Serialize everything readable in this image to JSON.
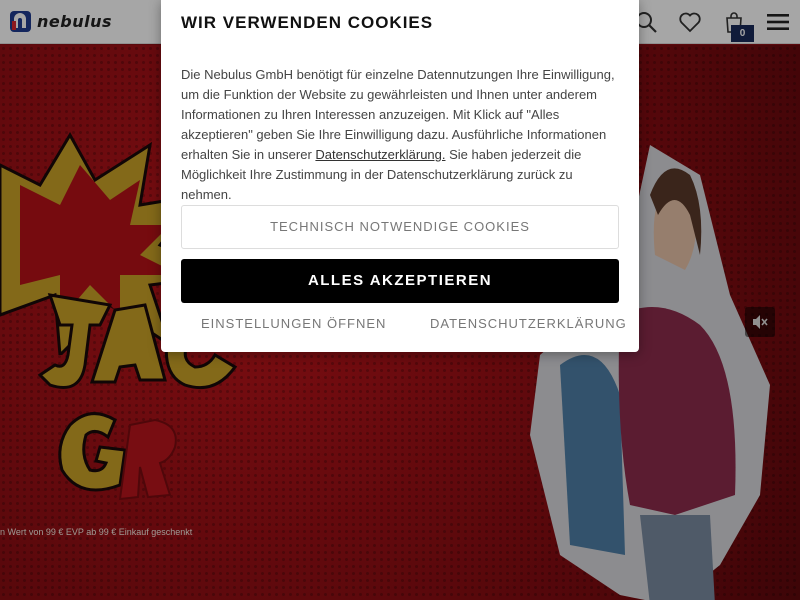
{
  "header": {
    "logo_text": "nebulus",
    "icons": [
      "search-icon",
      "heart-icon",
      "shopping-bag-icon",
      "menu-icon"
    ],
    "cart_count": "0"
  },
  "hero": {
    "caption": "n Wert von 99 € EVP ab 99 € Einkauf geschenkt",
    "mute_icon": "volume-mute-icon"
  },
  "cookie_modal": {
    "title": "WIR VERWENDEN COOKIES",
    "text_part1": "Die Nebulus GmbH benötigt für einzelne Datennutzungen Ihre Einwilligung, um die Funktion der Website zu gewährleisten und Ihnen unter anderem Informationen zu Ihren Interessen anzuzeigen. Mit Klick auf \"Alles akzeptieren\" geben Sie Ihre Einwilligung dazu. Ausführliche Informationen erhalten Sie in unserer ",
    "text_link": "Datenschutzerklärung.",
    "text_part2": " Sie haben jederzeit die Möglichkeit Ihre Zustimmung in der Datenschutzerklärung zurück zu nehmen.",
    "btn_necessary": "TECHNISCH NOTWENDIGE COOKIES",
    "btn_accept": "ALLES AKZEPTIEREN",
    "link_settings": "EINSTELLUNGEN ÖFFNEN",
    "link_privacy": "DATENSCHUTZERKLÄRUNG"
  },
  "colors": {
    "hero_red": "#a01016",
    "accept_bg": "#000000",
    "badge_bg": "#1a2a5a",
    "logo_blue": "#1f3b8f",
    "logo_red": "#d7262e"
  }
}
